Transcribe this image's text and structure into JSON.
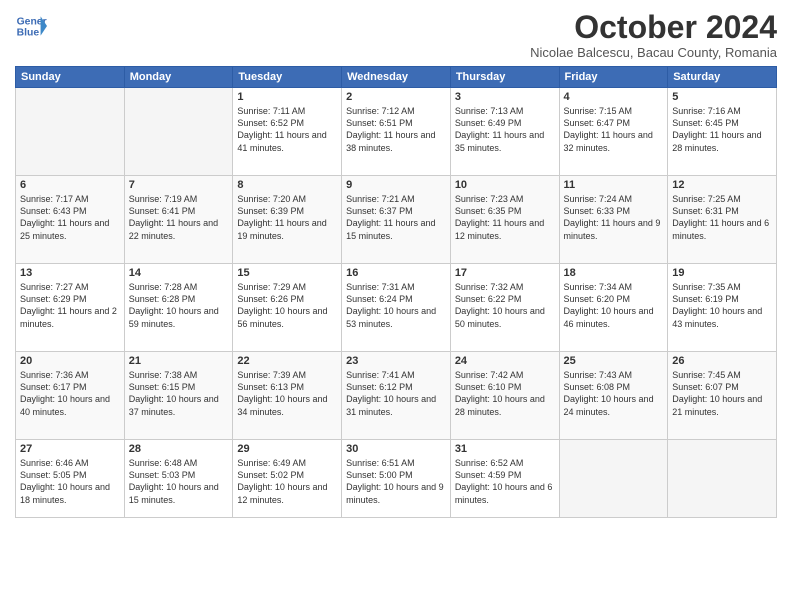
{
  "header": {
    "logo_line1": "General",
    "logo_line2": "Blue",
    "month": "October 2024",
    "location": "Nicolae Balcescu, Bacau County, Romania"
  },
  "weekdays": [
    "Sunday",
    "Monday",
    "Tuesday",
    "Wednesday",
    "Thursday",
    "Friday",
    "Saturday"
  ],
  "weeks": [
    [
      {
        "day": "",
        "info": ""
      },
      {
        "day": "",
        "info": ""
      },
      {
        "day": "1",
        "info": "Sunrise: 7:11 AM\nSunset: 6:52 PM\nDaylight: 11 hours and 41 minutes."
      },
      {
        "day": "2",
        "info": "Sunrise: 7:12 AM\nSunset: 6:51 PM\nDaylight: 11 hours and 38 minutes."
      },
      {
        "day": "3",
        "info": "Sunrise: 7:13 AM\nSunset: 6:49 PM\nDaylight: 11 hours and 35 minutes."
      },
      {
        "day": "4",
        "info": "Sunrise: 7:15 AM\nSunset: 6:47 PM\nDaylight: 11 hours and 32 minutes."
      },
      {
        "day": "5",
        "info": "Sunrise: 7:16 AM\nSunset: 6:45 PM\nDaylight: 11 hours and 28 minutes."
      }
    ],
    [
      {
        "day": "6",
        "info": "Sunrise: 7:17 AM\nSunset: 6:43 PM\nDaylight: 11 hours and 25 minutes."
      },
      {
        "day": "7",
        "info": "Sunrise: 7:19 AM\nSunset: 6:41 PM\nDaylight: 11 hours and 22 minutes."
      },
      {
        "day": "8",
        "info": "Sunrise: 7:20 AM\nSunset: 6:39 PM\nDaylight: 11 hours and 19 minutes."
      },
      {
        "day": "9",
        "info": "Sunrise: 7:21 AM\nSunset: 6:37 PM\nDaylight: 11 hours and 15 minutes."
      },
      {
        "day": "10",
        "info": "Sunrise: 7:23 AM\nSunset: 6:35 PM\nDaylight: 11 hours and 12 minutes."
      },
      {
        "day": "11",
        "info": "Sunrise: 7:24 AM\nSunset: 6:33 PM\nDaylight: 11 hours and 9 minutes."
      },
      {
        "day": "12",
        "info": "Sunrise: 7:25 AM\nSunset: 6:31 PM\nDaylight: 11 hours and 6 minutes."
      }
    ],
    [
      {
        "day": "13",
        "info": "Sunrise: 7:27 AM\nSunset: 6:29 PM\nDaylight: 11 hours and 2 minutes."
      },
      {
        "day": "14",
        "info": "Sunrise: 7:28 AM\nSunset: 6:28 PM\nDaylight: 10 hours and 59 minutes."
      },
      {
        "day": "15",
        "info": "Sunrise: 7:29 AM\nSunset: 6:26 PM\nDaylight: 10 hours and 56 minutes."
      },
      {
        "day": "16",
        "info": "Sunrise: 7:31 AM\nSunset: 6:24 PM\nDaylight: 10 hours and 53 minutes."
      },
      {
        "day": "17",
        "info": "Sunrise: 7:32 AM\nSunset: 6:22 PM\nDaylight: 10 hours and 50 minutes."
      },
      {
        "day": "18",
        "info": "Sunrise: 7:34 AM\nSunset: 6:20 PM\nDaylight: 10 hours and 46 minutes."
      },
      {
        "day": "19",
        "info": "Sunrise: 7:35 AM\nSunset: 6:19 PM\nDaylight: 10 hours and 43 minutes."
      }
    ],
    [
      {
        "day": "20",
        "info": "Sunrise: 7:36 AM\nSunset: 6:17 PM\nDaylight: 10 hours and 40 minutes."
      },
      {
        "day": "21",
        "info": "Sunrise: 7:38 AM\nSunset: 6:15 PM\nDaylight: 10 hours and 37 minutes."
      },
      {
        "day": "22",
        "info": "Sunrise: 7:39 AM\nSunset: 6:13 PM\nDaylight: 10 hours and 34 minutes."
      },
      {
        "day": "23",
        "info": "Sunrise: 7:41 AM\nSunset: 6:12 PM\nDaylight: 10 hours and 31 minutes."
      },
      {
        "day": "24",
        "info": "Sunrise: 7:42 AM\nSunset: 6:10 PM\nDaylight: 10 hours and 28 minutes."
      },
      {
        "day": "25",
        "info": "Sunrise: 7:43 AM\nSunset: 6:08 PM\nDaylight: 10 hours and 24 minutes."
      },
      {
        "day": "26",
        "info": "Sunrise: 7:45 AM\nSunset: 6:07 PM\nDaylight: 10 hours and 21 minutes."
      }
    ],
    [
      {
        "day": "27",
        "info": "Sunrise: 6:46 AM\nSunset: 5:05 PM\nDaylight: 10 hours and 18 minutes."
      },
      {
        "day": "28",
        "info": "Sunrise: 6:48 AM\nSunset: 5:03 PM\nDaylight: 10 hours and 15 minutes."
      },
      {
        "day": "29",
        "info": "Sunrise: 6:49 AM\nSunset: 5:02 PM\nDaylight: 10 hours and 12 minutes."
      },
      {
        "day": "30",
        "info": "Sunrise: 6:51 AM\nSunset: 5:00 PM\nDaylight: 10 hours and 9 minutes."
      },
      {
        "day": "31",
        "info": "Sunrise: 6:52 AM\nSunset: 4:59 PM\nDaylight: 10 hours and 6 minutes."
      },
      {
        "day": "",
        "info": ""
      },
      {
        "day": "",
        "info": ""
      }
    ]
  ]
}
